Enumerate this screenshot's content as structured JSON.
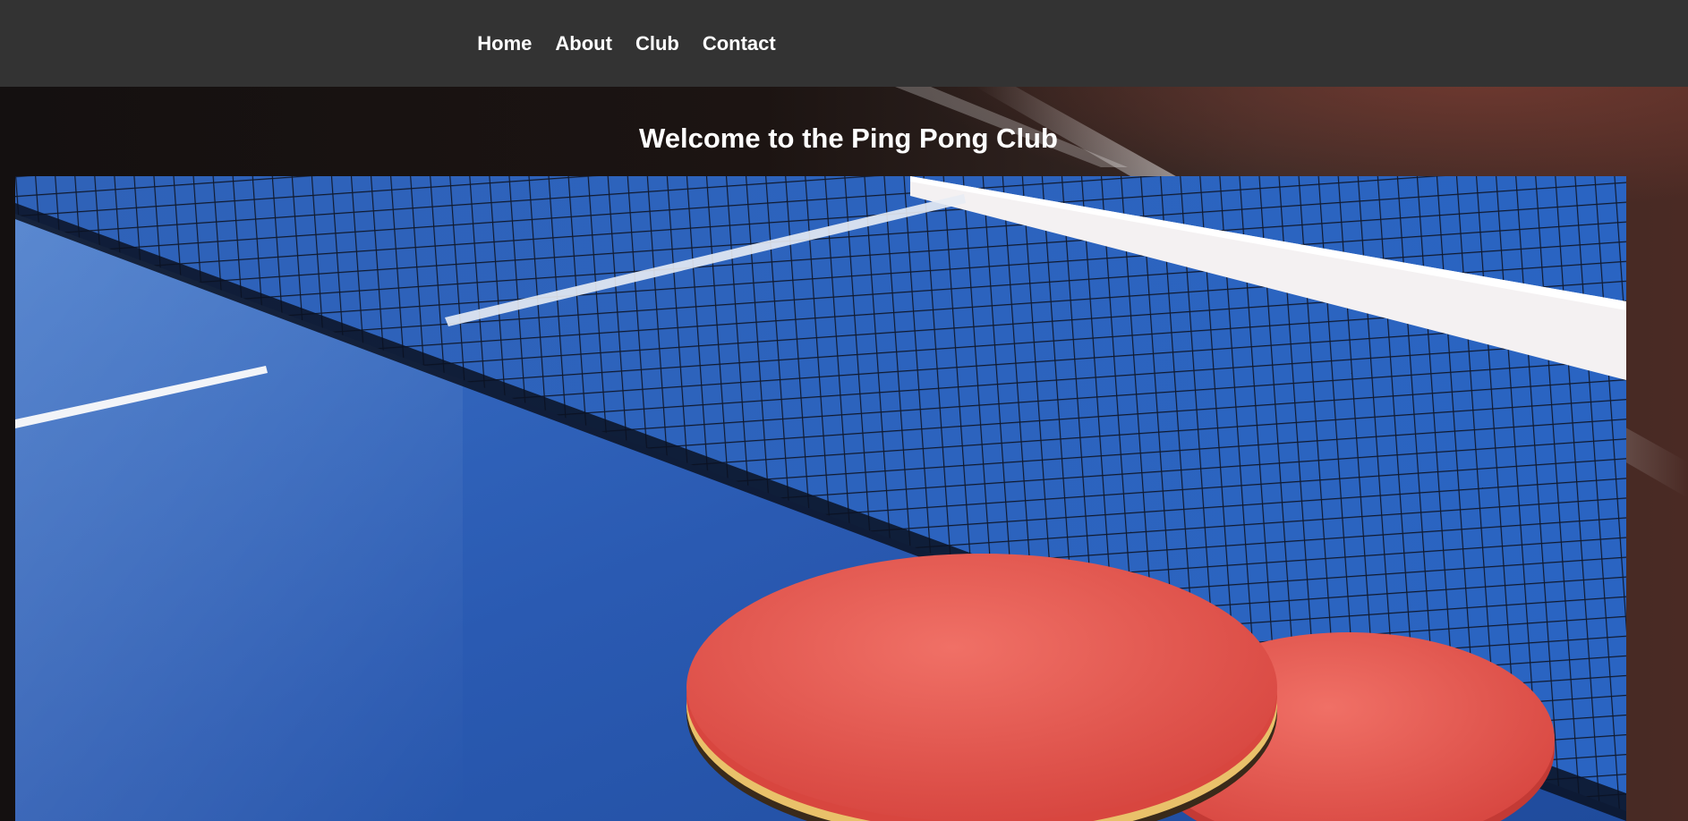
{
  "nav": {
    "items": [
      {
        "label": "Home"
      },
      {
        "label": "About"
      },
      {
        "label": "Club"
      },
      {
        "label": "Contact"
      }
    ]
  },
  "hero": {
    "title": "Welcome to the Ping Pong Club",
    "image_alt": "ping-pong-table-net-paddles-photo"
  },
  "colors": {
    "navbar_bg": "#333333",
    "nav_text": "#ffffff",
    "table_blue": "#2a5ab0",
    "paddle_red": "#e0504a"
  }
}
